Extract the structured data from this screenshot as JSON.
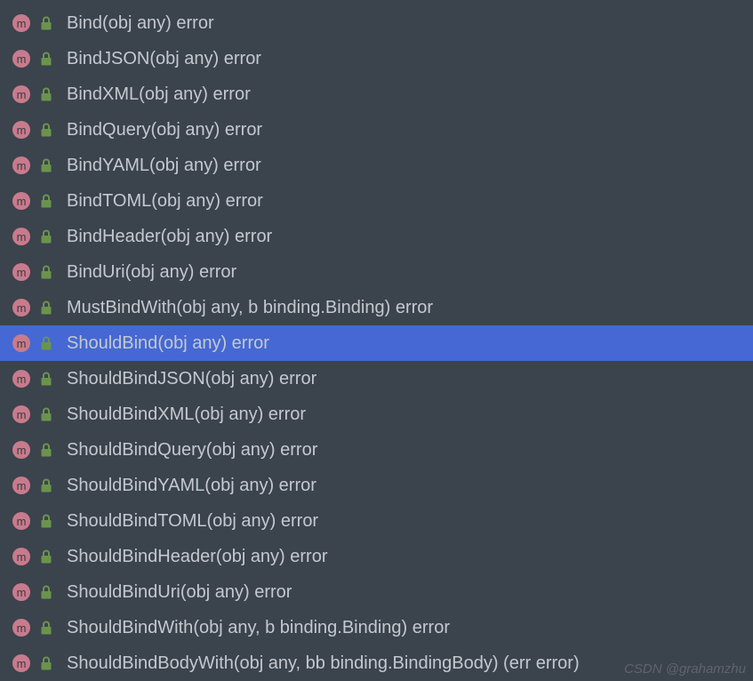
{
  "completions": [
    {
      "name": "Bind",
      "signature": "(obj any) error",
      "selected": false
    },
    {
      "name": "BindJSON",
      "signature": "(obj any) error",
      "selected": false
    },
    {
      "name": "BindXML",
      "signature": "(obj any) error",
      "selected": false
    },
    {
      "name": "BindQuery",
      "signature": "(obj any) error",
      "selected": false
    },
    {
      "name": "BindYAML",
      "signature": "(obj any) error",
      "selected": false
    },
    {
      "name": "BindTOML",
      "signature": "(obj any) error",
      "selected": false
    },
    {
      "name": "BindHeader",
      "signature": "(obj any) error",
      "selected": false
    },
    {
      "name": "BindUri",
      "signature": "(obj any) error",
      "selected": false
    },
    {
      "name": "MustBindWith",
      "signature": "(obj any, b binding.Binding) error",
      "selected": false
    },
    {
      "name": "ShouldBind",
      "signature": "(obj any) error",
      "selected": true
    },
    {
      "name": "ShouldBindJSON",
      "signature": "(obj any) error",
      "selected": false
    },
    {
      "name": "ShouldBindXML",
      "signature": "(obj any) error",
      "selected": false
    },
    {
      "name": "ShouldBindQuery",
      "signature": "(obj any) error",
      "selected": false
    },
    {
      "name": "ShouldBindYAML",
      "signature": "(obj any) error",
      "selected": false
    },
    {
      "name": "ShouldBindTOML",
      "signature": "(obj any) error",
      "selected": false
    },
    {
      "name": "ShouldBindHeader",
      "signature": "(obj any) error",
      "selected": false
    },
    {
      "name": "ShouldBindUri",
      "signature": "(obj any) error",
      "selected": false
    },
    {
      "name": "ShouldBindWith",
      "signature": "(obj any, b binding.Binding) error",
      "selected": false
    },
    {
      "name": "ShouldBindBodyWith",
      "signature": "(obj any, bb binding.BindingBody) (err error)",
      "selected": false
    }
  ],
  "icon_letter": "m",
  "watermark": "CSDN @grahamzhu"
}
